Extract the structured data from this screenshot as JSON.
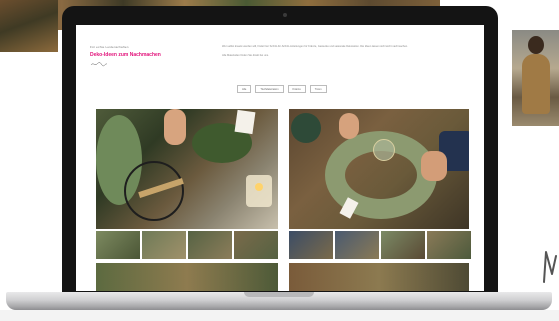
{
  "page": {
    "eyebrow": "Für echte Leidenschaften",
    "title": "Deko-Ideen zum Nachmachen",
    "intro_paragraphs": [
      "Wer selbst kreativ werden will, findet hier Schritt-für-Schritt-Anleitungen für Kränze, Gestecke und saisonale Dekoration. Die Ideen lassen sich leicht nachmachen.",
      "Alle Materialien finden Sie direkt bei uns."
    ]
  },
  "filters": [
    {
      "label": "Alle"
    },
    {
      "label": "Tischdekoration"
    },
    {
      "label": "Kränze"
    },
    {
      "label": "Türen"
    }
  ],
  "colors": {
    "brand_pink": "#e2127a",
    "laptop_bezel": "#141414"
  }
}
